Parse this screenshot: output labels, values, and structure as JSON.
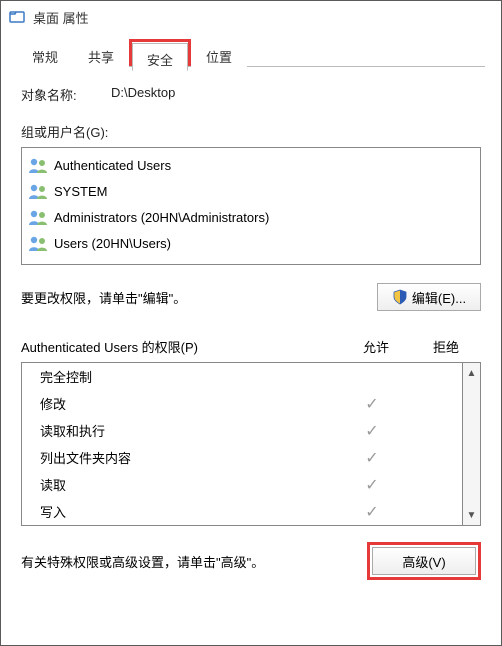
{
  "window": {
    "title": "桌面 属性"
  },
  "tabs": [
    {
      "label": "常规",
      "active": false,
      "highlight": false
    },
    {
      "label": "共享",
      "active": false,
      "highlight": false
    },
    {
      "label": "安全",
      "active": true,
      "highlight": true
    },
    {
      "label": "位置",
      "active": false,
      "highlight": false
    }
  ],
  "object": {
    "label": "对象名称:",
    "value": "D:\\Desktop"
  },
  "groups": {
    "label": "组或用户名(G):",
    "items": [
      {
        "name": "Authenticated Users",
        "selected": true
      },
      {
        "name": "SYSTEM",
        "selected": false
      },
      {
        "name": "Administrators (20HN\\Administrators)",
        "selected": false
      },
      {
        "name": "Users (20HN\\Users)",
        "selected": false
      }
    ]
  },
  "edit": {
    "hint": "要更改权限，请单击\"编辑\"。",
    "button": "编辑(E)..."
  },
  "permissions": {
    "header_label": "Authenticated Users 的权限(P)",
    "col_allow": "允许",
    "col_deny": "拒绝",
    "rows": [
      {
        "name": "完全控制",
        "allow": false,
        "deny": false
      },
      {
        "name": "修改",
        "allow": true,
        "deny": false
      },
      {
        "name": "读取和执行",
        "allow": true,
        "deny": false
      },
      {
        "name": "列出文件夹内容",
        "allow": true,
        "deny": false
      },
      {
        "name": "读取",
        "allow": true,
        "deny": false
      },
      {
        "name": "写入",
        "allow": true,
        "deny": false
      }
    ]
  },
  "advanced": {
    "hint": "有关特殊权限或高级设置，请单击\"高级\"。",
    "button": "高级(V)"
  }
}
